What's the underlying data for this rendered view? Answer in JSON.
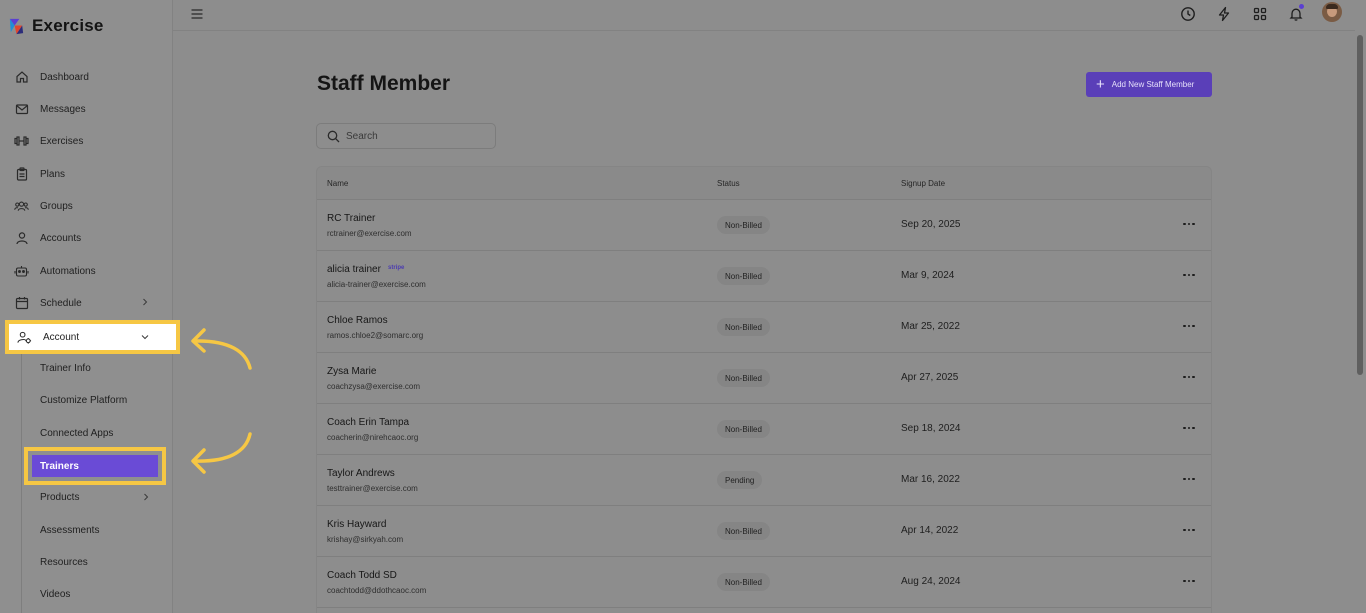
{
  "app": {
    "name": "Exercise"
  },
  "sidebar": {
    "items": [
      {
        "label": "Dashboard",
        "icon": "home-icon"
      },
      {
        "label": "Messages",
        "icon": "mail-icon"
      },
      {
        "label": "Exercises",
        "icon": "dumbbell-icon"
      },
      {
        "label": "Plans",
        "icon": "clipboard-icon"
      },
      {
        "label": "Groups",
        "icon": "group-icon"
      },
      {
        "label": "Accounts",
        "icon": "user-icon"
      },
      {
        "label": "Automations",
        "icon": "robot-icon"
      },
      {
        "label": "Schedule",
        "icon": "calendar-icon"
      }
    ],
    "account": {
      "label": "Account",
      "icon": "user-settings-icon",
      "expanded": true
    },
    "account_sub": [
      "Trainer Info",
      "Customize Platform",
      "Connected Apps"
    ],
    "trainers": {
      "label": "Trainers",
      "active": true
    },
    "more_sub": [
      "Products",
      "Assessments",
      "Resources",
      "Videos"
    ]
  },
  "topbar": {
    "icons": [
      "menu-icon",
      "clock-icon",
      "bolt-icon",
      "apps-grid-icon",
      "bell-icon",
      "avatar"
    ]
  },
  "page": {
    "title": "Staff Member",
    "add_button": "Add New Staff Member",
    "search_placeholder": "Search"
  },
  "table": {
    "columns": {
      "name": "Name",
      "status": "Status",
      "signup": "Signup Date"
    },
    "rows": [
      {
        "name": "RC Trainer",
        "email": "rctrainer@exercise.com",
        "status": "Non-Billed",
        "date": "Sep 20, 2025",
        "stripe": ""
      },
      {
        "name": "alicia trainer",
        "email": "alicia-trainer@exercise.com",
        "status": "Non-Billed",
        "date": "Mar 9, 2024",
        "stripe": "stripe"
      },
      {
        "name": "Chloe Ramos",
        "email": "ramos.chloe2@somarc.org",
        "status": "Non-Billed",
        "date": "Mar 25, 2022",
        "stripe": ""
      },
      {
        "name": "Zysa Marie",
        "email": "coachzysa@exercise.com",
        "status": "Non-Billed",
        "date": "Apr 27, 2025",
        "stripe": ""
      },
      {
        "name": "Coach Erin Tampa",
        "email": "coacherin@nirehcaoc.org",
        "status": "Non-Billed",
        "date": "Sep 18, 2024",
        "stripe": ""
      },
      {
        "name": "Taylor Andrews",
        "email": "testtrainer@exercise.com",
        "status": "Pending",
        "date": "Mar 16, 2022",
        "stripe": ""
      },
      {
        "name": "Kris Hayward",
        "email": "krishay@sirkyah.com",
        "status": "Non-Billed",
        "date": "Apr 14, 2022",
        "stripe": ""
      },
      {
        "name": "Coach Todd SD",
        "email": "coachtodd@ddothcaoc.com",
        "status": "Non-Billed",
        "date": "Aug 24, 2024",
        "stripe": ""
      }
    ]
  },
  "colors": {
    "accent": "#5a3fb8",
    "highlight": "#f6c744",
    "active": "#6a4bd6"
  }
}
